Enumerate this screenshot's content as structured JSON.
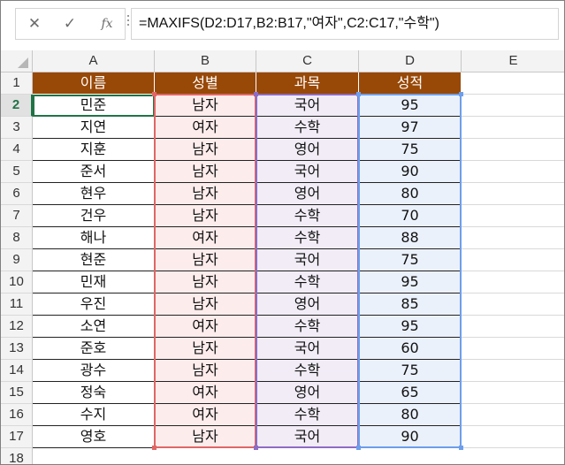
{
  "formula_bar": {
    "cancel_icon": "✕",
    "enter_icon": "✓",
    "fx_label": "fx",
    "formula": "=MAXIFS(D2:D17,B2:B17,\"여자\",C2:C17,\"수학\")"
  },
  "columns": [
    "A",
    "B",
    "C",
    "D",
    "E"
  ],
  "header_row": {
    "row_num": "1",
    "a": "이름",
    "b": "성별",
    "c": "과목",
    "d": "성적"
  },
  "rows": [
    {
      "row_num": "2",
      "a": "민준",
      "b": "남자",
      "c": "국어",
      "d": "95"
    },
    {
      "row_num": "3",
      "a": "지연",
      "b": "여자",
      "c": "수학",
      "d": "97"
    },
    {
      "row_num": "4",
      "a": "지훈",
      "b": "남자",
      "c": "영어",
      "d": "75"
    },
    {
      "row_num": "5",
      "a": "준서",
      "b": "남자",
      "c": "국어",
      "d": "90"
    },
    {
      "row_num": "6",
      "a": "현우",
      "b": "남자",
      "c": "영어",
      "d": "80"
    },
    {
      "row_num": "7",
      "a": "건우",
      "b": "남자",
      "c": "수학",
      "d": "70"
    },
    {
      "row_num": "8",
      "a": "해나",
      "b": "여자",
      "c": "수학",
      "d": "88"
    },
    {
      "row_num": "9",
      "a": "현준",
      "b": "남자",
      "c": "국어",
      "d": "75"
    },
    {
      "row_num": "10",
      "a": "민재",
      "b": "남자",
      "c": "수학",
      "d": "95"
    },
    {
      "row_num": "11",
      "a": "우진",
      "b": "남자",
      "c": "영어",
      "d": "85"
    },
    {
      "row_num": "12",
      "a": "소연",
      "b": "여자",
      "c": "수학",
      "d": "95"
    },
    {
      "row_num": "13",
      "a": "준호",
      "b": "남자",
      "c": "국어",
      "d": "60"
    },
    {
      "row_num": "14",
      "a": "광수",
      "b": "남자",
      "c": "수학",
      "d": "75"
    },
    {
      "row_num": "15",
      "a": "정숙",
      "b": "여자",
      "c": "영어",
      "d": "65"
    },
    {
      "row_num": "16",
      "a": "수지",
      "b": "여자",
      "c": "수학",
      "d": "80"
    },
    {
      "row_num": "17",
      "a": "영호",
      "b": "남자",
      "c": "국어",
      "d": "90"
    }
  ],
  "partial_row_num": "18",
  "colors": {
    "header_fill": "#984807",
    "header_text": "#ffffff",
    "range_b_border": "#e06666",
    "range_c_border": "#8e6cc4",
    "range_d_border": "#6d9eeb",
    "active_cell_border": "#217346"
  }
}
